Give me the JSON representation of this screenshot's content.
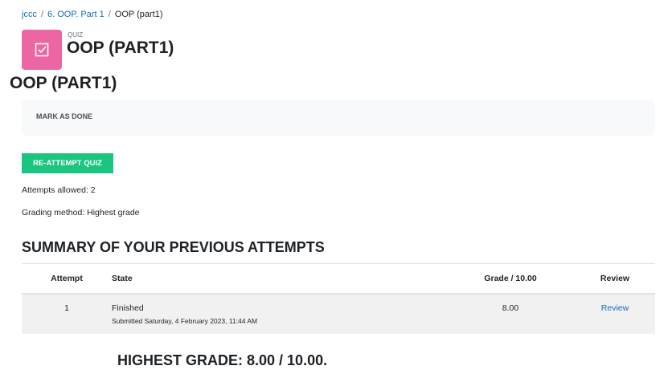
{
  "breadcrumb": [
    "jccc",
    "6. OOP. Part 1",
    "OOP (part1)"
  ],
  "header": {
    "type": "QUIZ",
    "title": "OOP (PART1)",
    "icon": "quiz-checkbox-icon",
    "icon_color": "#eb66a2"
  },
  "page_title": "OOP (PART1)",
  "mark_done": "MARK AS DONE",
  "reattempt": "RE-ATTEMPT QUIZ",
  "attempts_allowed": "Attempts allowed: 2",
  "grading_method": "Grading method: Highest grade",
  "summary_title": "SUMMARY OF YOUR PREVIOUS ATTEMPTS",
  "table": {
    "headers": [
      "Attempt",
      "State",
      "Grade / 10.00",
      "Review"
    ],
    "rows": [
      {
        "attempt": "1",
        "state": "Finished",
        "submitted": "Submitted Saturday, 4 February 2023, 11:44 AM",
        "grade": "8.00",
        "review": "Review"
      }
    ]
  },
  "highest_grade": "HIGHEST GRADE: 8.00 / 10.00."
}
